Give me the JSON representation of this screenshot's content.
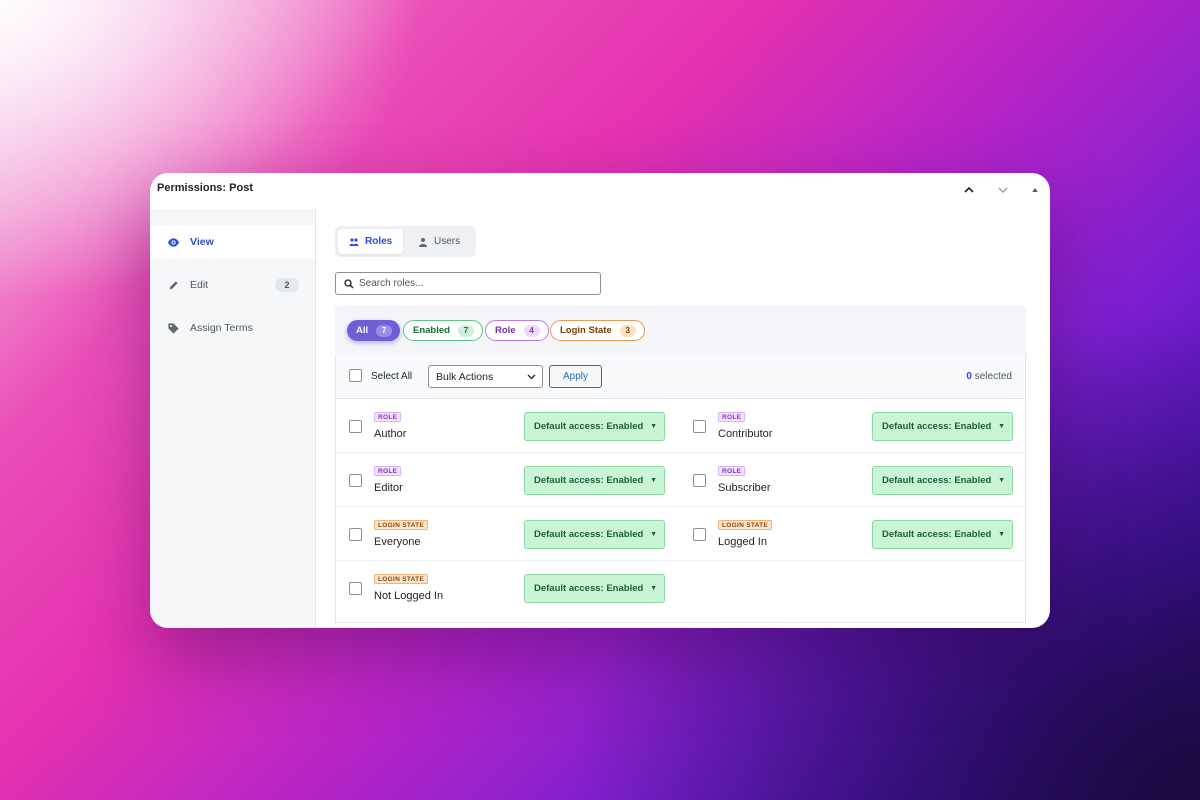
{
  "window": {
    "title": "Permissions: Post",
    "controls": [
      "chevron-up-icon",
      "chevron-down-icon",
      "triangle-up-icon"
    ]
  },
  "sidebar": {
    "items": [
      {
        "label": "View",
        "icon": "eye-icon",
        "active": true,
        "badge": null
      },
      {
        "label": "Edit",
        "icon": "pencil-icon",
        "active": false,
        "badge": "2"
      },
      {
        "label": "Assign Terms",
        "icon": "tag-icon",
        "active": false,
        "badge": null
      }
    ]
  },
  "tabs": [
    {
      "label": "Roles",
      "icon": "group-icon",
      "active": true
    },
    {
      "label": "Users",
      "icon": "user-icon",
      "active": false
    }
  ],
  "search": {
    "placeholder": "Search roles...",
    "value": ""
  },
  "filters": [
    {
      "label": "All",
      "count": "7",
      "active": true
    },
    {
      "label": "Enabled",
      "count": "7",
      "active": false
    },
    {
      "label": "Role",
      "count": "4",
      "active": false
    },
    {
      "label": "Login State",
      "count": "3",
      "active": false
    }
  ],
  "bulk": {
    "select_all_label": "Select All",
    "actions_value": "Bulk Actions",
    "apply_label": "Apply",
    "selected_count": "0",
    "selected_suffix": " selected"
  },
  "rows": [
    {
      "tag": "ROLE",
      "type": "role",
      "name": "Author",
      "access": "Default access: Enabled"
    },
    {
      "tag": "ROLE",
      "type": "role",
      "name": "Contributor",
      "access": "Default access: Enabled"
    },
    {
      "tag": "ROLE",
      "type": "role",
      "name": "Editor",
      "access": "Default access: Enabled"
    },
    {
      "tag": "ROLE",
      "type": "role",
      "name": "Subscriber",
      "access": "Default access: Enabled"
    },
    {
      "tag": "LOGIN STATE",
      "type": "login",
      "name": "Everyone",
      "access": "Default access: Enabled"
    },
    {
      "tag": "LOGIN STATE",
      "type": "login",
      "name": "Logged In",
      "access": "Default access: Enabled"
    },
    {
      "tag": "LOGIN STATE",
      "type": "login",
      "name": "Not Logged In",
      "access": "Default access: Enabled"
    }
  ],
  "colors": {
    "accent": "#2c4bd6",
    "all_chip": "#6d5fd6",
    "enabled_green": "#c9f5d6",
    "role_purple": "#8a2fcf",
    "login_orange": "#8a4609"
  }
}
